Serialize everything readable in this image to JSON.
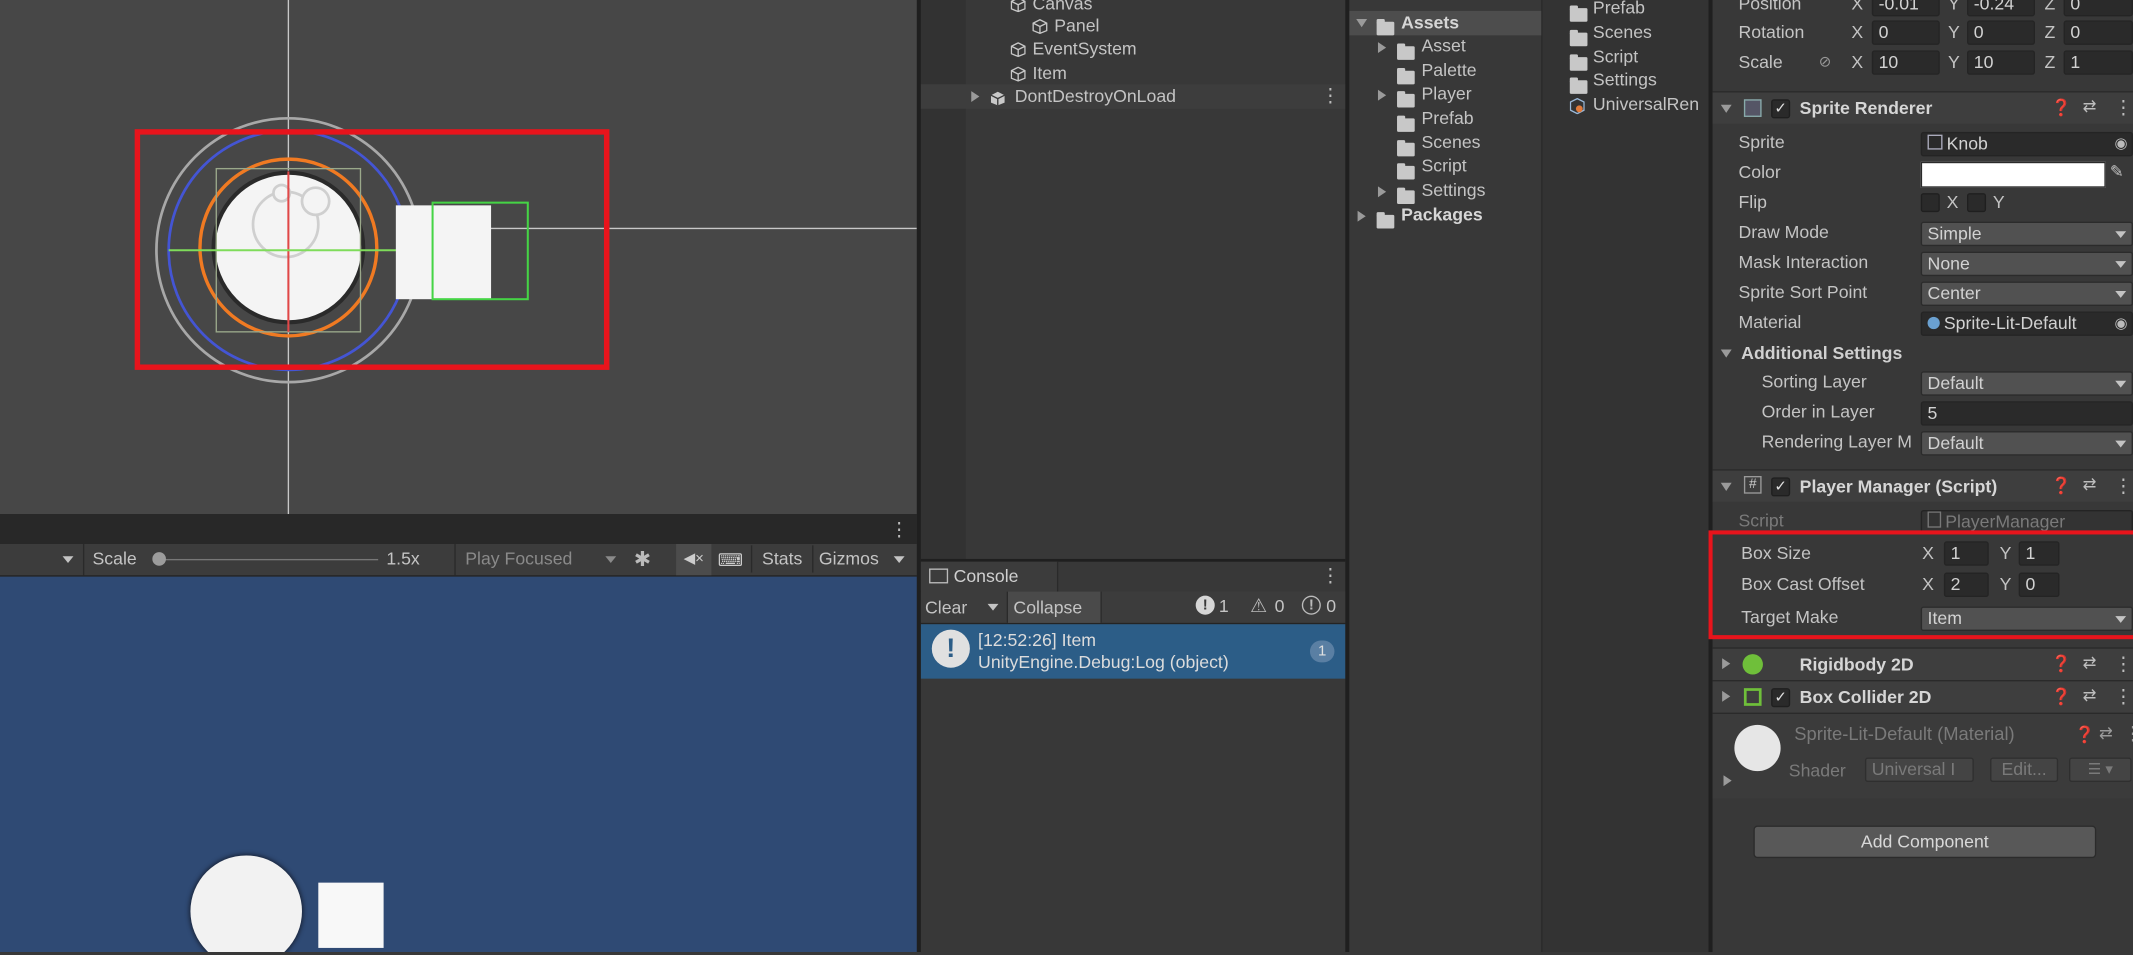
{
  "hierarchy": {
    "items": [
      {
        "label": "Canvas",
        "indent": 2
      },
      {
        "label": "Panel",
        "indent": 3
      },
      {
        "label": "EventSystem",
        "indent": 2
      },
      {
        "label": "Item",
        "indent": 2
      }
    ],
    "dont_destroy": "DontDestroyOnLoad"
  },
  "project": {
    "assets_root": "Assets",
    "tree": [
      "Asset",
      "Palette",
      "Player",
      "Prefab",
      "Scenes",
      "Script",
      "Settings"
    ],
    "packages": "Packages",
    "content": [
      "Prefab",
      "Scenes",
      "Script",
      "Settings",
      "UniversalRen"
    ]
  },
  "game_toolbar": {
    "scale_label": "Scale",
    "scale_value": 0.1,
    "scale_text": "1.5x",
    "play_mode": "Play Focused",
    "stats": "Stats",
    "gizmos": "Gizmos"
  },
  "console": {
    "title": "Console",
    "clear": "Clear",
    "collapse": "Collapse",
    "log_count": "1",
    "warn_count": "0",
    "error_count": "0",
    "entry_line1": "[12:52:26] Item",
    "entry_line2": "UnityEngine.Debug:Log (object)",
    "entry_count": "1"
  },
  "inspector": {
    "transform": {
      "position_label": "Position",
      "pos_x": "-0.01",
      "pos_y": "-0.24",
      "pos_z": "0",
      "rotation_label": "Rotation",
      "rot_x": "0",
      "rot_y": "0",
      "rot_z": "0",
      "scale_label": "Scale",
      "scale_x": "10",
      "scale_y": "10",
      "scale_z": "1"
    },
    "sprite_renderer": {
      "title": "Sprite Renderer",
      "sprite_label": "Sprite",
      "sprite_value": "Knob",
      "color_label": "Color",
      "flip_label": "Flip",
      "flip_x": "X",
      "flip_y": "Y",
      "draw_mode_label": "Draw Mode",
      "draw_mode": "Simple",
      "mask_label": "Mask Interaction",
      "mask": "None",
      "sort_point_label": "Sprite Sort Point",
      "sort_point": "Center",
      "material_label": "Material",
      "material": "Sprite-Lit-Default",
      "additional": "Additional Settings",
      "sorting_layer_label": "Sorting Layer",
      "sorting_layer": "Default",
      "order_label": "Order in Layer",
      "order": "5",
      "rendering_layer_label": "Rendering Layer M",
      "rendering_layer": "Default"
    },
    "player_manager": {
      "title": "Player Manager (Script)",
      "script_label": "Script",
      "script_value": "PlayerManager",
      "box_size_label": "Box Size",
      "box_size_x": "1",
      "box_size_y": "1",
      "offset_label": "Box Cast Offset",
      "offset_x": "2",
      "offset_y": "0",
      "target_label": "Target Make",
      "target": "Item"
    },
    "rigidbody": {
      "title": "Rigidbody 2D"
    },
    "box_collider": {
      "title": "Box Collider 2D"
    },
    "material_preview": {
      "title": "Sprite-Lit-Default (Material)",
      "shader_label": "Shader",
      "shader": "Universal I",
      "edit": "Edit..."
    },
    "add_component": "Add Component"
  },
  "colors": {
    "highlight_red": "#e8141c",
    "game_view_bg": "#2f4a74",
    "scene_bg": "#474747",
    "selection_blue": "#2c5d87"
  }
}
